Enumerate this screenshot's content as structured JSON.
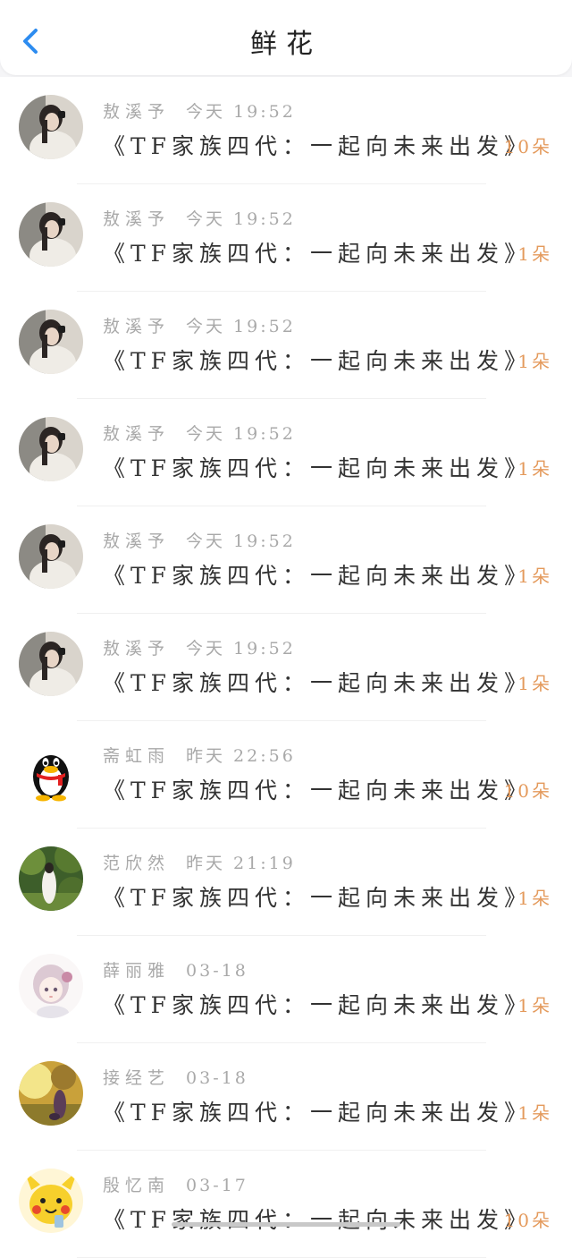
{
  "header": {
    "title": "鲜花",
    "back_icon": "chevron-left-icon",
    "accent_color": "#2d8cf0"
  },
  "items": [
    {
      "name": "敖溪予",
      "time": "今天 19:52",
      "gift": "《TF家族四代：一起向未来出发》",
      "count": "10朵",
      "avatar": "photo-girl"
    },
    {
      "name": "敖溪予",
      "time": "今天 19:52",
      "gift": "《TF家族四代：一起向未来出发》",
      "count": "1朵",
      "avatar": "photo-girl"
    },
    {
      "name": "敖溪予",
      "time": "今天 19:52",
      "gift": "《TF家族四代：一起向未来出发》",
      "count": "1朵",
      "avatar": "photo-girl"
    },
    {
      "name": "敖溪予",
      "time": "今天 19:52",
      "gift": "《TF家族四代：一起向未来出发》",
      "count": "1朵",
      "avatar": "photo-girl"
    },
    {
      "name": "敖溪予",
      "time": "今天 19:52",
      "gift": "《TF家族四代：一起向未来出发》",
      "count": "1朵",
      "avatar": "photo-girl"
    },
    {
      "name": "敖溪予",
      "time": "今天 19:52",
      "gift": "《TF家族四代：一起向未来出发》",
      "count": "1朵",
      "avatar": "photo-girl"
    },
    {
      "name": "斋虹雨",
      "time": "昨天 22:56",
      "gift": "《TF家族四代：一起向未来出发》",
      "count": "10朵",
      "avatar": "penguin"
    },
    {
      "name": "范欣然",
      "time": "昨天 21:19",
      "gift": "《TF家族四代：一起向未来出发》",
      "count": "1朵",
      "avatar": "forest"
    },
    {
      "name": "薛丽雅",
      "time": "03-18",
      "gift": "《TF家族四代：一起向未来出发》",
      "count": "1朵",
      "avatar": "anime"
    },
    {
      "name": "接经艺",
      "time": "03-18",
      "gift": "《TF家族四代：一起向未来出发》",
      "count": "1朵",
      "avatar": "sunset"
    },
    {
      "name": "殷忆南",
      "time": "03-17",
      "gift": "《TF家族四代：一起向未来出发》",
      "count": "10朵",
      "avatar": "pikachu"
    }
  ],
  "colors": {
    "count": "#e49a5c",
    "meta": "#a9a9a9",
    "text": "#333333"
  }
}
